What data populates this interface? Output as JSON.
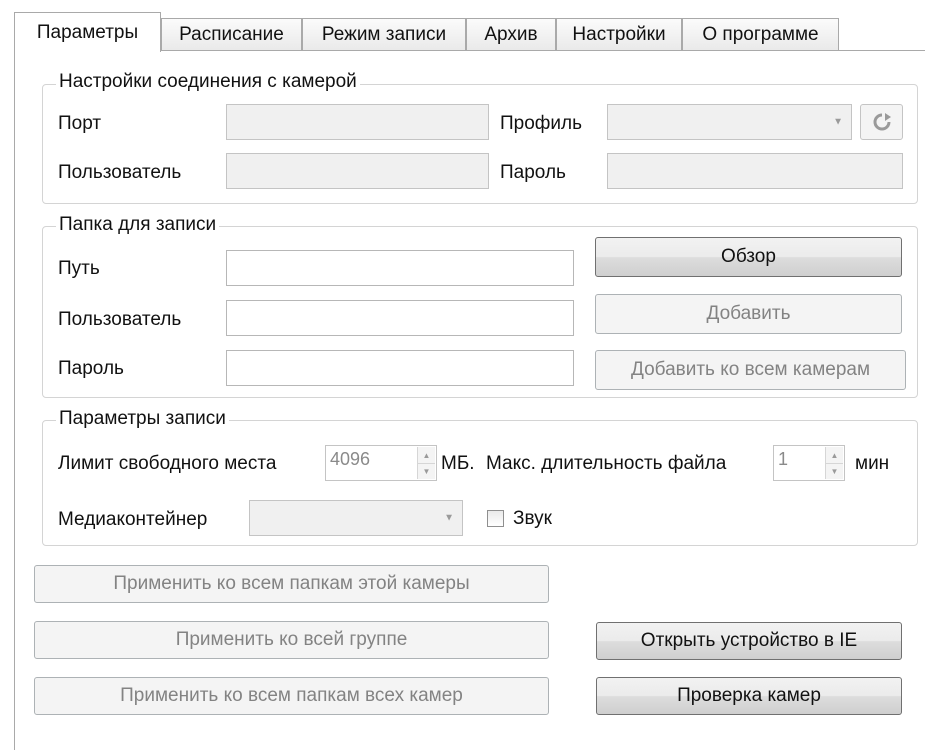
{
  "tabs": [
    {
      "label": "Параметры",
      "active": true
    },
    {
      "label": "Расписание",
      "active": false
    },
    {
      "label": "Режим записи",
      "active": false
    },
    {
      "label": "Архив",
      "active": false
    },
    {
      "label": "Настройки",
      "active": false
    },
    {
      "label": "О программе",
      "active": false
    }
  ],
  "connection": {
    "title": "Настройки соединения с камерой",
    "port_label": "Порт",
    "port_value": "",
    "user_label": "Пользователь",
    "user_value": "",
    "profile_label": "Профиль",
    "profile_value": "",
    "password_label": "Пароль",
    "password_value": "",
    "refresh_icon": "refresh-icon"
  },
  "folder": {
    "title": "Папка для записи",
    "path_label": "Путь",
    "path_value": "",
    "user_label": "Пользователь",
    "user_value": "",
    "password_label": "Пароль",
    "password_value": "",
    "browse_button": "Обзор",
    "add_button": "Добавить",
    "add_all_button": "Добавить ко всем камерам"
  },
  "record": {
    "title": "Параметры записи",
    "free_space_label": "Лимит свободного места",
    "free_space_value": "4096",
    "free_space_unit": "МБ.",
    "max_duration_label": "Макс. длительность файла",
    "max_duration_value": "1",
    "max_duration_unit": "мин",
    "container_label": "Медиаконтейнер",
    "container_value": "",
    "sound_label": "Звук",
    "sound_checked": false
  },
  "actions": {
    "apply_camera_folders": "Применить ко всем папкам этой камеры",
    "apply_group": "Применить ко всей группе",
    "apply_all_cameras": "Применить ко всем папкам всех камер",
    "open_in_ie": "Открыть устройство в IE",
    "check_cameras": "Проверка камер"
  },
  "colors": {
    "border": "#a9a9a9",
    "disabled_text": "#838383",
    "disabled_field": "#f0f0f0"
  }
}
